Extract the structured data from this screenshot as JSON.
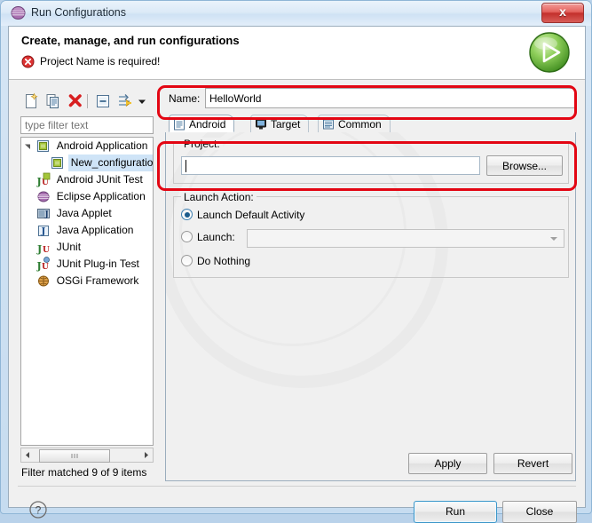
{
  "window": {
    "title": "Run Configurations",
    "title_icon": "eclipse-sphere-icon",
    "close_label": "x"
  },
  "header": {
    "title": "Create, manage, and run configurations",
    "message": "Project Name is required!",
    "error_icon": "error-circle-icon",
    "run_icon": "run-play-icon"
  },
  "toolbar": {
    "buttons": [
      {
        "name": "new-launch-configuration-icon",
        "tip": "New launch configuration"
      },
      {
        "name": "duplicate-icon",
        "tip": "Duplicate"
      },
      {
        "name": "delete-icon",
        "tip": "Delete"
      },
      {
        "name": "collapse-all-icon",
        "tip": "Collapse All"
      },
      {
        "name": "filter-icon",
        "tip": "Filter"
      },
      {
        "name": "chevron-down-icon",
        "tip": "View Menu"
      }
    ]
  },
  "filter": {
    "placeholder": "type filter text",
    "value": "",
    "status": "Filter matched 9 of 9 items"
  },
  "tree": {
    "items": [
      {
        "label": "Android Application",
        "icon": "android-app-icon",
        "indent": 0,
        "expanded": true,
        "selected": false
      },
      {
        "label": "New_configuration",
        "icon": "android-app-icon",
        "indent": 1,
        "expanded": false,
        "selected": true
      },
      {
        "label": "Android JUnit Test",
        "icon": "android-junit-icon",
        "indent": 0,
        "expanded": false,
        "selected": false
      },
      {
        "label": "Eclipse Application",
        "icon": "eclipse-sphere-icon",
        "indent": 0,
        "expanded": false,
        "selected": false
      },
      {
        "label": "Java Applet",
        "icon": "java-applet-icon",
        "indent": 0,
        "expanded": false,
        "selected": false
      },
      {
        "label": "Java Application",
        "icon": "java-application-icon",
        "indent": 0,
        "expanded": false,
        "selected": false
      },
      {
        "label": "JUnit",
        "icon": "junit-icon",
        "indent": 0,
        "expanded": false,
        "selected": false
      },
      {
        "label": "JUnit Plug-in Test",
        "icon": "junit-plugin-icon",
        "indent": 0,
        "expanded": false,
        "selected": false
      },
      {
        "label": "OSGi Framework",
        "icon": "osgi-icon",
        "indent": 0,
        "expanded": false,
        "selected": false
      }
    ]
  },
  "config": {
    "name_label": "Name:",
    "name_value": "HelloWorld",
    "tabs": [
      {
        "label": "Android",
        "icon": "android-tab-icon",
        "selected": true
      },
      {
        "label": "Target",
        "icon": "target-monitor-icon",
        "selected": false
      },
      {
        "label": "Common",
        "icon": "common-list-icon",
        "selected": false
      }
    ],
    "project": {
      "group_title": "Project:",
      "value": "",
      "browse_label": "Browse..."
    },
    "launch_action": {
      "group_title": "Launch Action:",
      "options": [
        {
          "label": "Launch Default Activity",
          "selected": true
        },
        {
          "label": "Launch:",
          "selected": false
        },
        {
          "label": "Do Nothing",
          "selected": false
        }
      ],
      "combo_value": ""
    }
  },
  "buttons": {
    "apply": "Apply",
    "revert": "Revert",
    "run": "Run",
    "close": "Close",
    "help_icon": "help-question-icon"
  },
  "colors": {
    "annotation": "#e30613",
    "accent": "#3c97c9",
    "panel": "#f0f0f0",
    "title_gradient_top": "#eaf3fb"
  }
}
